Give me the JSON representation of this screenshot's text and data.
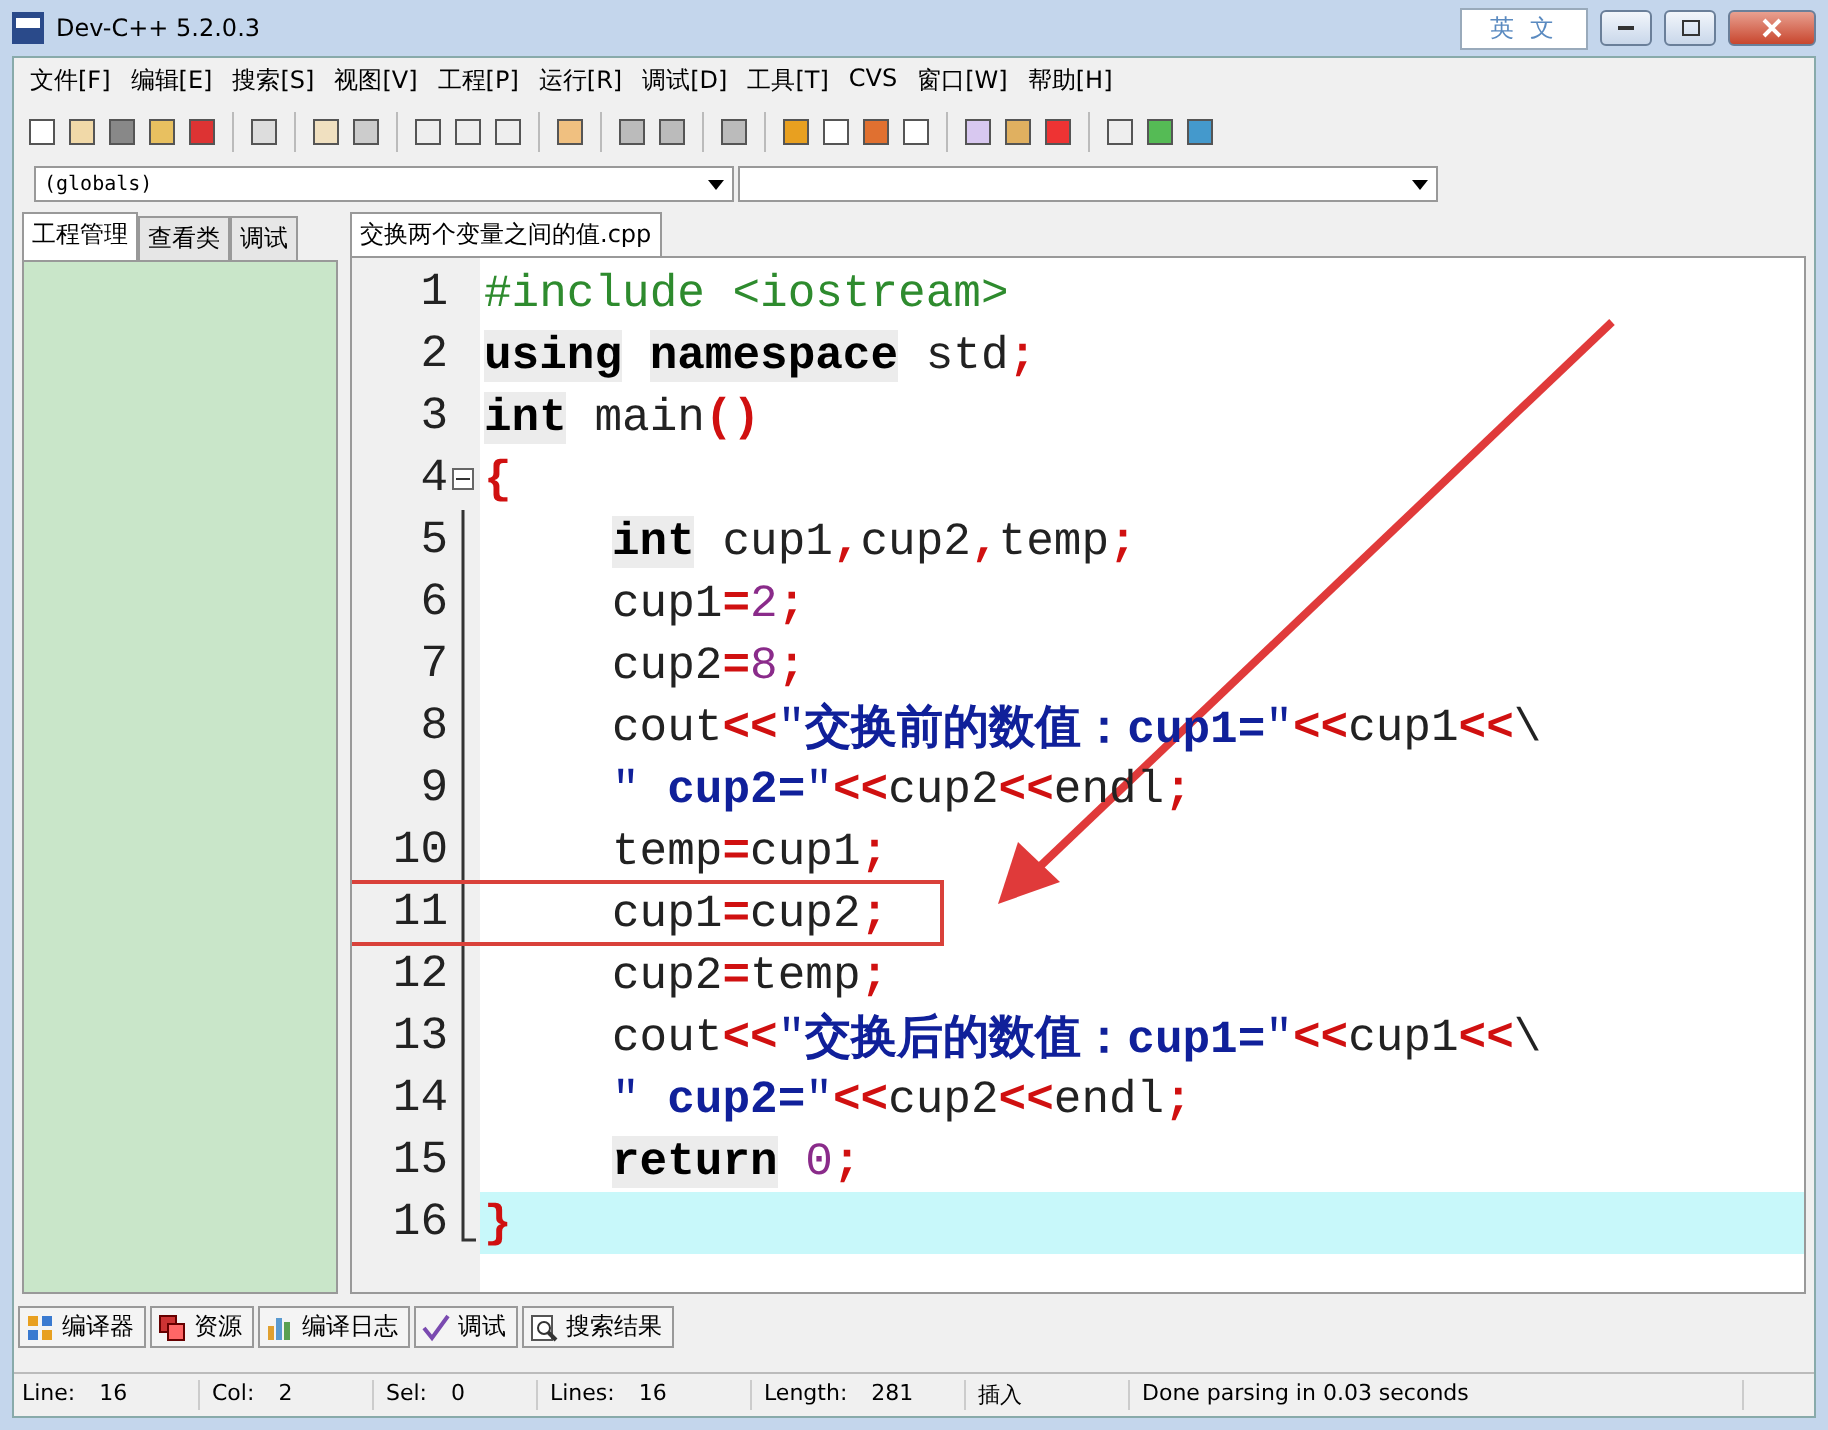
{
  "window": {
    "title": "Dev-C++ 5.2.0.3",
    "ime": "英 文"
  },
  "menu": [
    "文件[F]",
    "编辑[E]",
    "搜索[S]",
    "视图[V]",
    "工程[P]",
    "运行[R]",
    "调试[D]",
    "工具[T]",
    "CVS",
    "窗口[W]",
    "帮助[H]"
  ],
  "symbol_combo": {
    "value": "(globals)"
  },
  "left_tabs": [
    {
      "label": "工程管理",
      "selected": true
    },
    {
      "label": "查看类",
      "selected": false
    },
    {
      "label": "调试",
      "selected": false
    }
  ],
  "editor_tabs": [
    {
      "label": "交换两个变量之间的值.cpp",
      "selected": true
    }
  ],
  "code": [
    {
      "num": "1",
      "indented": false,
      "current": false,
      "boxed": false,
      "tokens": [
        {
          "kind": "pre",
          "text": "#include <iostream>"
        }
      ]
    },
    {
      "num": "2",
      "indented": false,
      "current": false,
      "boxed": false,
      "tokens": [
        {
          "kind": "kw",
          "text": "using"
        },
        {
          "kind": "kw",
          "text": "namespace"
        },
        {
          "kind": "plain",
          "text": " std"
        },
        {
          "kind": "sym",
          "text": ";"
        }
      ]
    },
    {
      "num": "3",
      "indented": false,
      "current": false,
      "boxed": false,
      "tokens": [
        {
          "kind": "kw",
          "text": "int"
        },
        {
          "kind": "plain",
          "text": " main"
        },
        {
          "kind": "sym",
          "text": "()"
        }
      ]
    },
    {
      "num": "4",
      "indented": false,
      "current": false,
      "boxed": false,
      "expanded": true,
      "tokens": [
        {
          "kind": "sym",
          "text": "{"
        }
      ],
      "children": [
        {
          "num": "5",
          "indented": true,
          "current": false,
          "boxed": false,
          "tokens": [
            {
              "kind": "kw",
              "text": "int"
            },
            {
              "kind": "plain",
              "text": " cup1"
            },
            {
              "kind": "sym",
              "text": ","
            },
            {
              "kind": "plain",
              "text": "cup2"
            },
            {
              "kind": "sym",
              "text": ","
            },
            {
              "kind": "plain",
              "text": "temp"
            },
            {
              "kind": "sym",
              "text": ";"
            }
          ]
        },
        {
          "num": "6",
          "indented": true,
          "current": false,
          "boxed": false,
          "tokens": [
            {
              "kind": "plain",
              "text": "cup1"
            },
            {
              "kind": "sym",
              "text": "="
            },
            {
              "kind": "num",
              "text": "2"
            },
            {
              "kind": "sym",
              "text": ";"
            }
          ]
        },
        {
          "num": "7",
          "indented": true,
          "current": false,
          "boxed": false,
          "tokens": [
            {
              "kind": "plain",
              "text": "cup2"
            },
            {
              "kind": "sym",
              "text": "="
            },
            {
              "kind": "num",
              "text": "8"
            },
            {
              "kind": "sym",
              "text": ";"
            }
          ]
        },
        {
          "num": "8",
          "indented": true,
          "current": false,
          "boxed": false,
          "tokens": [
            {
              "kind": "plain",
              "text": "cout"
            },
            {
              "kind": "sym",
              "text": "<<"
            },
            {
              "kind": "quote",
              "text": "\""
            },
            {
              "kind": "str",
              "text": "交换前的数值：cup1="
            },
            {
              "kind": "quote",
              "text": "\""
            },
            {
              "kind": "sym",
              "text": "<<"
            },
            {
              "kind": "plain",
              "text": "cup1"
            },
            {
              "kind": "sym",
              "text": "<<"
            },
            {
              "kind": "plain",
              "text": "\\"
            }
          ]
        },
        {
          "num": "9",
          "indented": true,
          "current": false,
          "boxed": false,
          "tokens": [
            {
              "kind": "quote",
              "text": "\""
            },
            {
              "kind": "str",
              "text": " cup2="
            },
            {
              "kind": "quote",
              "text": "\""
            },
            {
              "kind": "sym",
              "text": "<<"
            },
            {
              "kind": "plain",
              "text": "cup2"
            },
            {
              "kind": "sym",
              "text": "<<"
            },
            {
              "kind": "plain",
              "text": "endl"
            },
            {
              "kind": "sym",
              "text": ";"
            }
          ]
        },
        {
          "num": "10",
          "indented": true,
          "current": false,
          "boxed": false,
          "tokens": [
            {
              "kind": "plain",
              "text": "temp"
            },
            {
              "kind": "sym",
              "text": "="
            },
            {
              "kind": "plain",
              "text": "cup1"
            },
            {
              "kind": "sym",
              "text": ";"
            }
          ]
        },
        {
          "num": "11",
          "indented": true,
          "current": false,
          "boxed": true,
          "tokens": [
            {
              "kind": "plain",
              "text": "cup1"
            },
            {
              "kind": "sym",
              "text": "="
            },
            {
              "kind": "plain",
              "text": "cup2"
            },
            {
              "kind": "sym",
              "text": ";"
            }
          ]
        },
        {
          "num": "12",
          "indented": true,
          "current": false,
          "boxed": false,
          "tokens": [
            {
              "kind": "plain",
              "text": "cup2"
            },
            {
              "kind": "sym",
              "text": "="
            },
            {
              "kind": "plain",
              "text": "temp"
            },
            {
              "kind": "sym",
              "text": ";"
            }
          ]
        },
        {
          "num": "13",
          "indented": true,
          "current": false,
          "boxed": false,
          "tokens": [
            {
              "kind": "plain",
              "text": "cout"
            },
            {
              "kind": "sym",
              "text": "<<"
            },
            {
              "kind": "quote",
              "text": "\""
            },
            {
              "kind": "str",
              "text": "交换后的数值：cup1="
            },
            {
              "kind": "quote",
              "text": "\""
            },
            {
              "kind": "sym",
              "text": "<<"
            },
            {
              "kind": "plain",
              "text": "cup1"
            },
            {
              "kind": "sym",
              "text": "<<"
            },
            {
              "kind": "plain",
              "text": "\\"
            }
          ]
        },
        {
          "num": "14",
          "indented": true,
          "current": false,
          "boxed": false,
          "tokens": [
            {
              "kind": "quote",
              "text": "\""
            },
            {
              "kind": "str",
              "text": " cup2="
            },
            {
              "kind": "quote",
              "text": "\""
            },
            {
              "kind": "sym",
              "text": "<<"
            },
            {
              "kind": "plain",
              "text": "cup2"
            },
            {
              "kind": "sym",
              "text": "<<"
            },
            {
              "kind": "plain",
              "text": "endl"
            },
            {
              "kind": "sym",
              "text": ";"
            }
          ]
        },
        {
          "num": "15",
          "indented": true,
          "current": false,
          "boxed": false,
          "tokens": [
            {
              "kind": "kw",
              "text": "return"
            },
            {
              "kind": "num",
              "text": " 0"
            },
            {
              "kind": "sym",
              "text": ";"
            }
          ]
        },
        {
          "num": "16",
          "indented": false,
          "current": true,
          "boxed": false,
          "tokens": [
            {
              "kind": "sym",
              "text": "}"
            }
          ]
        }
      ]
    }
  ],
  "bottom_tabs": [
    {
      "label": "编译器"
    },
    {
      "label": "资源"
    },
    {
      "label": "编译日志"
    },
    {
      "label": "调试"
    },
    {
      "label": "搜索结果"
    }
  ],
  "status_bar": [
    {
      "label": "Line:",
      "value": "16"
    },
    {
      "label": "Col:",
      "value": "2"
    },
    {
      "label": "Sel:",
      "value": "0"
    },
    {
      "label": "Lines:",
      "value": "16"
    },
    {
      "label": "Length:",
      "value": "281"
    },
    {
      "value": "插入"
    },
    {
      "value": "Done parsing in 0.03 seconds"
    }
  ]
}
